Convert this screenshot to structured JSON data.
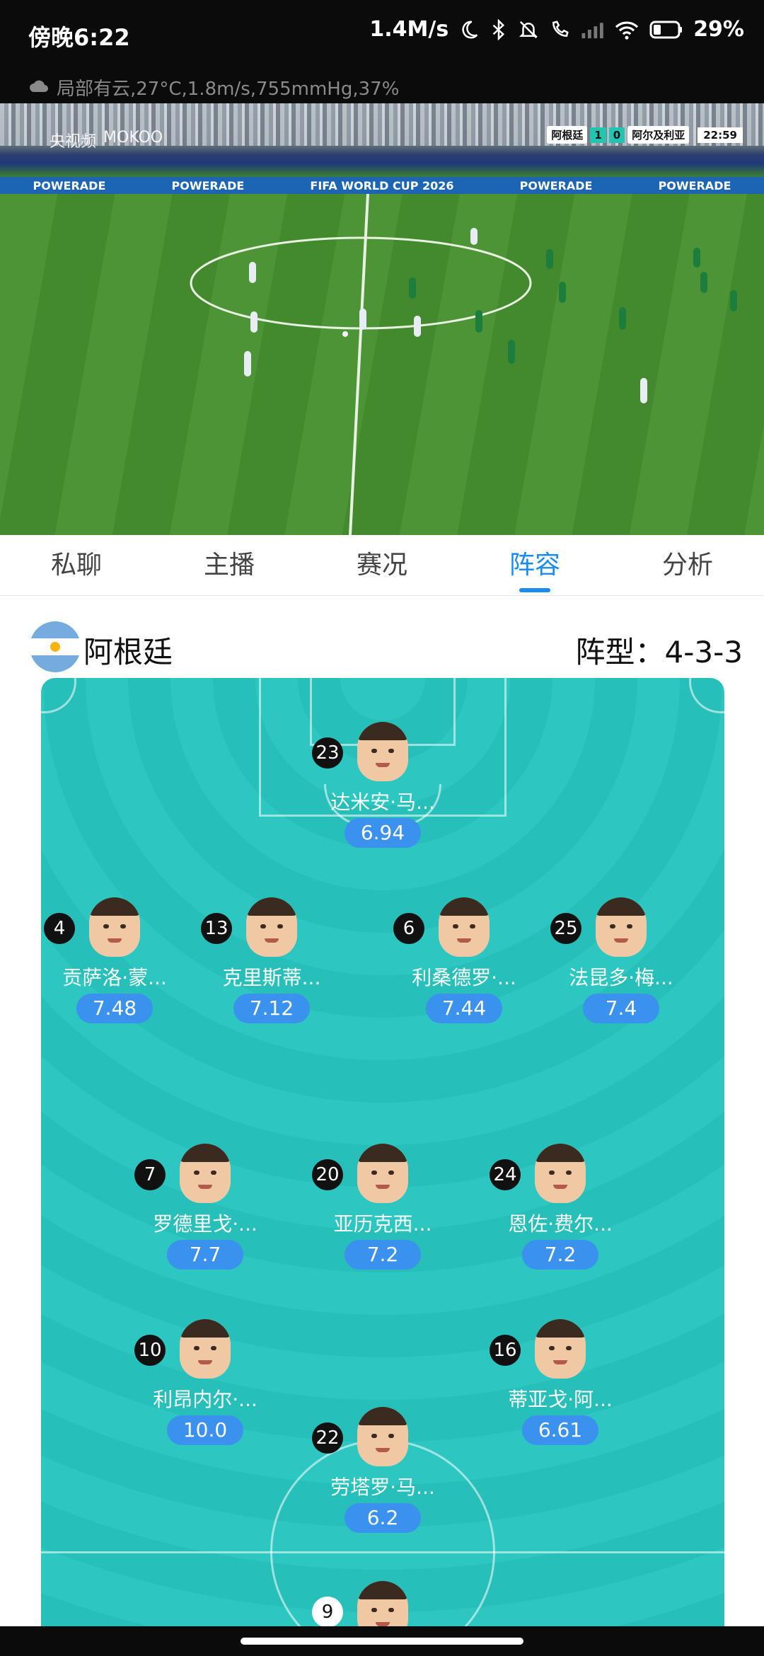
{
  "status": {
    "time": "傍晚6:22",
    "net_speed": "1.4M/s",
    "battery": "29%"
  },
  "weather_line": "局部有云,27°C,1.8m/s,755mmHg,37%",
  "video": {
    "broadcaster": "央视频",
    "brand": "MOKOO",
    "score": {
      "home": "阿根廷",
      "home_score": "1",
      "away_score": "0",
      "away": "阿尔及利亚",
      "clock": "22:59"
    },
    "ad_text": "POWERADE",
    "banner_text": "FIFA WORLD CUP 2026"
  },
  "tabs": [
    "私聊",
    "主播",
    "赛况",
    "阵容",
    "分析"
  ],
  "active_tab": 3,
  "team": {
    "name": "阿根廷",
    "formation": "阵型：4-3-3"
  },
  "players": [
    {
      "number": "23",
      "name": "达米安·马...",
      "rating": "6.94"
    },
    {
      "number": "4",
      "name": "贡萨洛·蒙...",
      "rating": "7.48"
    },
    {
      "number": "13",
      "name": "克里斯蒂...",
      "rating": "7.12"
    },
    {
      "number": "6",
      "name": "利桑德罗·...",
      "rating": "7.44"
    },
    {
      "number": "25",
      "name": "法昆多·梅...",
      "rating": "7.4"
    },
    {
      "number": "7",
      "name": "罗德里戈·...",
      "rating": "7.7"
    },
    {
      "number": "20",
      "name": "亚历克西...",
      "rating": "7.2"
    },
    {
      "number": "24",
      "name": "恩佐·费尔...",
      "rating": "7.2"
    },
    {
      "number": "10",
      "name": "利昂内尔·...",
      "rating": "10.0"
    },
    {
      "number": "16",
      "name": "蒂亚戈·阿...",
      "rating": "6.61"
    },
    {
      "number": "22",
      "name": "劳塔罗·马...",
      "rating": "6.2"
    },
    {
      "number": "9",
      "name": "",
      "rating": ""
    }
  ]
}
